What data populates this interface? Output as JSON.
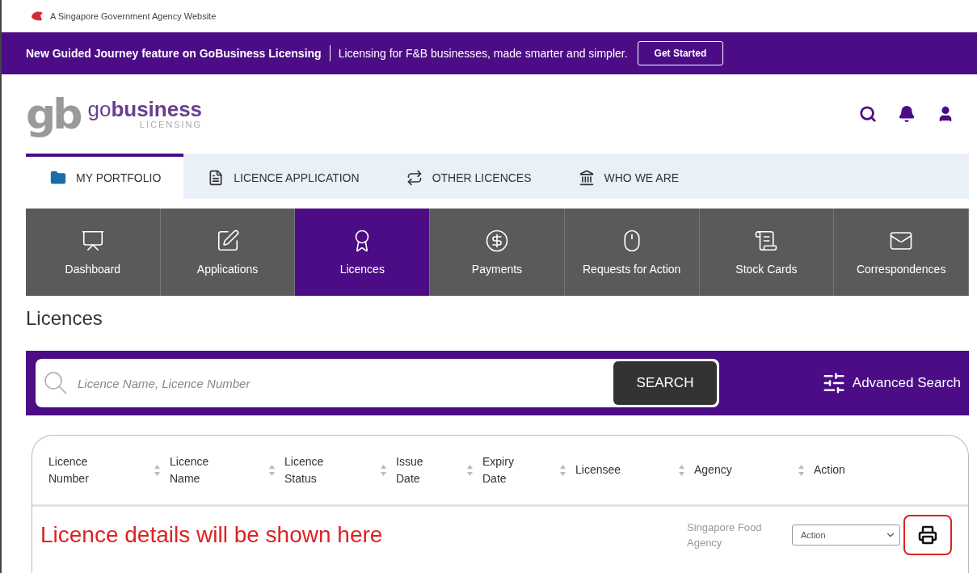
{
  "gov_bar": {
    "text": "A Singapore Government Agency Website"
  },
  "banner": {
    "title": "New Guided Journey feature on GoBusiness Licensing",
    "message": "Licensing for F&B businesses, made smarter and simpler.",
    "button": "Get Started"
  },
  "logo": {
    "mark": "gb",
    "name_light": "go",
    "name_bold": "business",
    "sub": "LICENSING"
  },
  "top_nav": [
    {
      "label": "MY PORTFOLIO",
      "selected": true
    },
    {
      "label": "LICENCE APPLICATION",
      "selected": false
    },
    {
      "label": "OTHER LICENCES",
      "selected": false
    },
    {
      "label": "WHO WE ARE",
      "selected": false
    }
  ],
  "tabs": [
    {
      "label": "Dashboard",
      "selected": false
    },
    {
      "label": "Applications",
      "selected": false
    },
    {
      "label": "Licences",
      "selected": true
    },
    {
      "label": "Payments",
      "selected": false
    },
    {
      "label": "Requests for Action",
      "selected": false
    },
    {
      "label": "Stock Cards",
      "selected": false
    },
    {
      "label": "Correspondences",
      "selected": false
    }
  ],
  "page_title": "Licences",
  "search": {
    "placeholder": "Licence Name, Licence Number",
    "button": "SEARCH",
    "advanced": "Advanced Search"
  },
  "table": {
    "columns": [
      {
        "label": "Licence Number",
        "sortable": true
      },
      {
        "label": "Licence Name",
        "sortable": true
      },
      {
        "label": "Licence Status",
        "sortable": true
      },
      {
        "label": "Issue Date",
        "sortable": true
      },
      {
        "label": "Expiry Date",
        "sortable": true
      },
      {
        "label": "Licensee",
        "sortable": true
      },
      {
        "label": "Agency",
        "sortable": true
      },
      {
        "label": "Action",
        "sortable": false
      }
    ],
    "note": "Licence details will be shown here",
    "rows": [
      {
        "agency": "Singapore Food Agency",
        "action": "Action",
        "print_highlighted": true
      }
    ]
  }
}
